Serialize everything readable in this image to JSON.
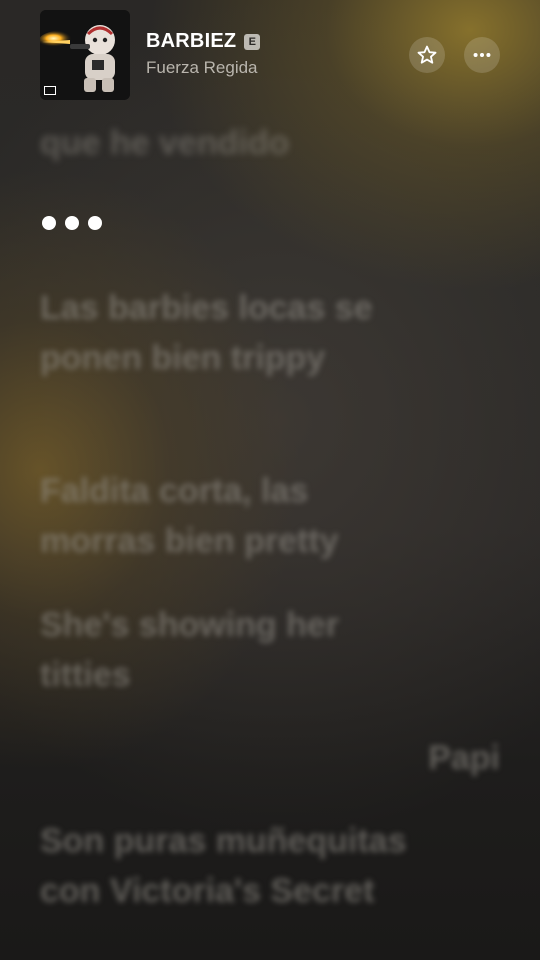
{
  "now_playing": {
    "title": "BARBIEZ",
    "explicit_badge": "E",
    "artist": "Fuerza Regida",
    "artwork_icon": "album-art-image"
  },
  "actions": {
    "favorite_icon": "star-icon",
    "more_icon": "ellipsis-icon"
  },
  "lyrics": [
    {
      "text": "que he vendido",
      "state": "past"
    },
    {
      "text": "",
      "state": "current",
      "indicator": "instrumental-dots"
    },
    {
      "text": "Las barbies locas se ponen bien trippy",
      "state": "upcoming"
    },
    {
      "text": "Faldita corta, las morras bien pretty",
      "state": "upcoming"
    },
    {
      "text": "She's showing her titties",
      "state": "upcoming"
    },
    {
      "text": "Papi",
      "state": "upcoming",
      "align": "right"
    },
    {
      "text": "Son puras muñequitas con Victoria's Secret",
      "state": "upcoming"
    }
  ],
  "colors": {
    "accent_gold": "#967d2d",
    "text_primary": "#ffffff",
    "text_secondary": "#b9b5ad",
    "lyric_dim": "#96928a"
  }
}
